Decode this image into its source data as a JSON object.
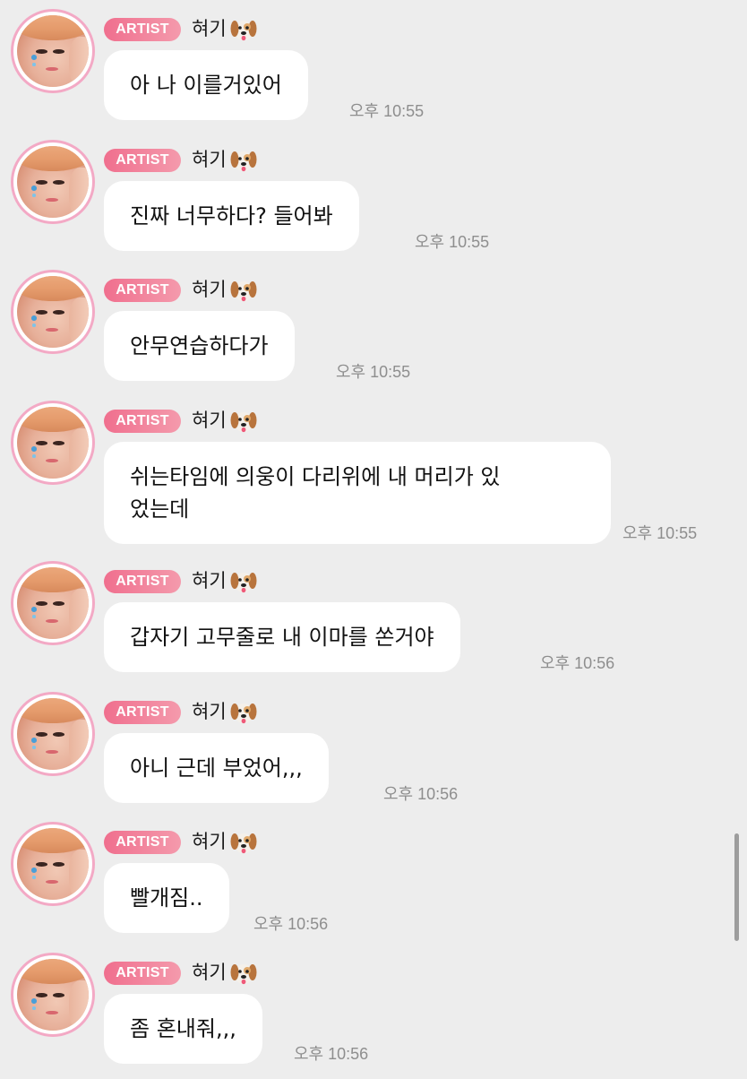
{
  "badge_label": "ARTIST",
  "sender_name": "혀기",
  "sender_emoji_icon": "dog-face-icon",
  "colors": {
    "background": "#ededed",
    "bubble": "#ffffff",
    "badge_start": "#f06f8e",
    "badge_end": "#f49aac",
    "avatar_ring": "#f3a9c5",
    "timestamp": "#8e8e8e"
  },
  "messages": [
    {
      "text": "아 나 이를거있어",
      "time": "오후 10:55"
    },
    {
      "text": "진짜 너무하다? 들어봐",
      "time": "오후 10:55"
    },
    {
      "text": "안무연습하다가",
      "time": "오후 10:55"
    },
    {
      "text": "쉬는타임에 의웅이 다리위에 내 머리가 있\n었는데",
      "time": "오후 10:55"
    },
    {
      "text": "갑자기 고무줄로 내 이마를 쏜거야",
      "time": "오후 10:56"
    },
    {
      "text": "아니 근데 부었어,,,",
      "time": "오후 10:56"
    },
    {
      "text": "빨개짐..",
      "time": "오후 10:56"
    },
    {
      "text": "좀 혼내줘,,,",
      "time": "오후 10:56"
    }
  ]
}
